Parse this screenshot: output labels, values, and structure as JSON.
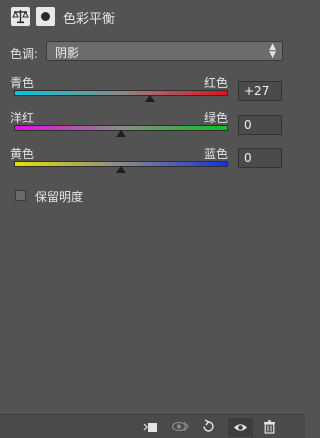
{
  "header": {
    "title": "色彩平衡",
    "icons": [
      "balance-scale-icon",
      "layer-mask-icon"
    ]
  },
  "tone": {
    "label": "色调:",
    "value": "阴影"
  },
  "sliders": [
    {
      "left_label": "青色",
      "right_label": "红色",
      "value": "+27",
      "level": 27
    },
    {
      "left_label": "洋红",
      "right_label": "绿色",
      "value": "0",
      "level": 0
    },
    {
      "left_label": "黄色",
      "right_label": "蓝色",
      "value": "0",
      "level": 0
    }
  ],
  "preserve_luminosity": {
    "label": "保留明度",
    "checked": false
  },
  "colors": {
    "panel_bg": "#535353",
    "cyan": "#00c8d8",
    "red": "#e01020",
    "magenta": "#e010e0",
    "green": "#10c020",
    "yellow": "#e8e000",
    "blue": "#1830e0"
  },
  "footer_icons": [
    "clip-to-layer-icon",
    "view-previous-icon",
    "reset-icon",
    "visibility-eye-icon",
    "trash-icon"
  ]
}
